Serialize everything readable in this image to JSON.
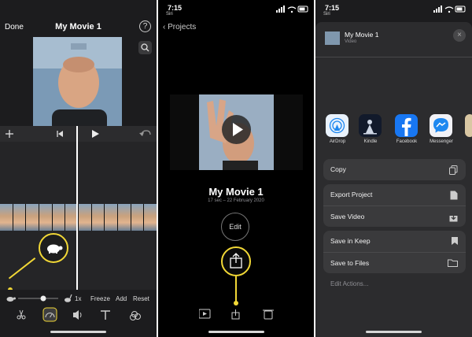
{
  "panel1": {
    "done_label": "Done",
    "title": "My Movie 1",
    "help_icon_text": "?",
    "speed_label": "1x",
    "freeze_label": "Freeze",
    "add_label": "Add",
    "reset_label": "Reset",
    "bottom_tools": [
      "scissors-icon",
      "speed-icon",
      "volume-icon",
      "text-icon",
      "filter-icon"
    ]
  },
  "panel2": {
    "status_time": "7:15",
    "back_label": "Siri",
    "nav_back": "Projects",
    "movie_title": "My Movie 1",
    "movie_meta": "17 sec – 22 February 2020",
    "edit_label": "Edit"
  },
  "panel3": {
    "status_time": "7:15",
    "back_label": "Siri",
    "share_title": "My Movie 1",
    "share_subtitle": "Video",
    "close_icon": "×",
    "apps": [
      {
        "label": "AirDrop",
        "color": "#e9f2fc"
      },
      {
        "label": "Kindle",
        "color": "#121a2b"
      },
      {
        "label": "Facebook",
        "color": "#1877f2"
      },
      {
        "label": "Messenger",
        "color": "#f2f2f7"
      }
    ],
    "actions": {
      "copy": "Copy",
      "export_project": "Export Project",
      "save_video": "Save Video",
      "save_keep": "Save in Keep",
      "save_files": "Save to Files",
      "edit_actions": "Edit Actions..."
    }
  },
  "colors": {
    "accent_yellow": "#f2d836",
    "dark_bg": "#1c1c1e",
    "sheet_bg": "#2c2c2e"
  }
}
